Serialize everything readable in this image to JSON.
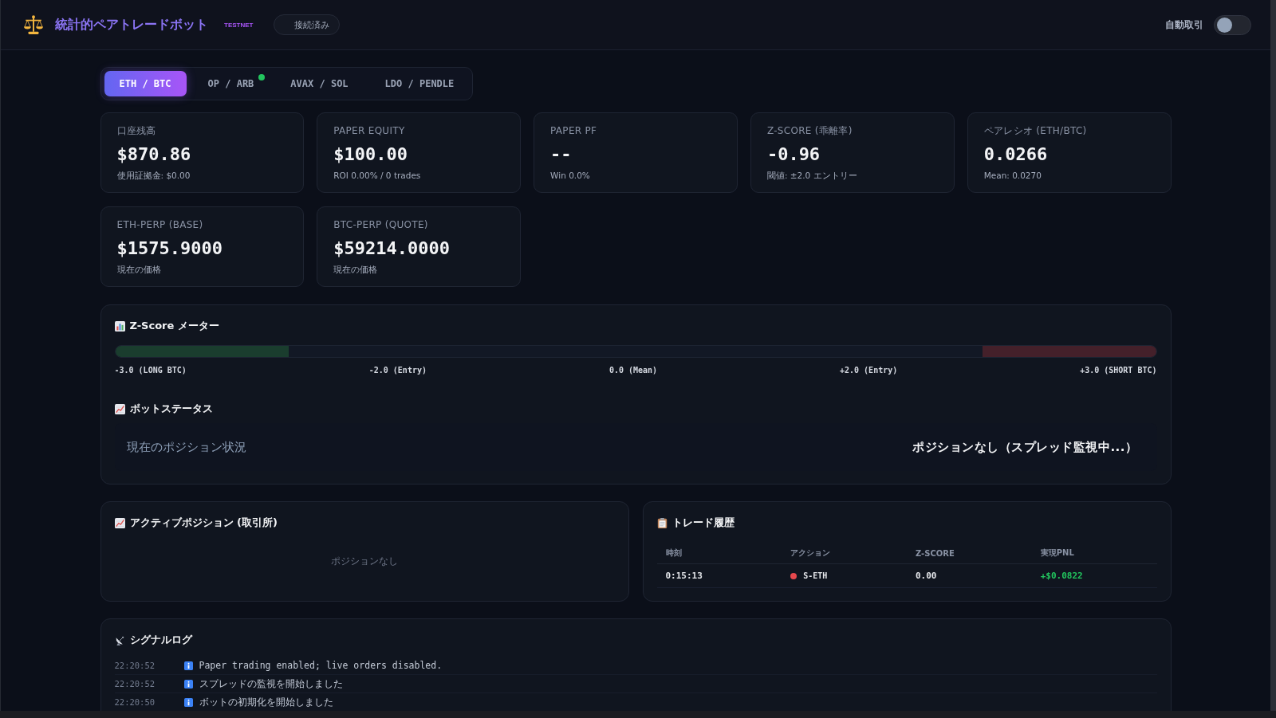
{
  "header": {
    "title": "統計的ペアトレードボット",
    "badge": "TESTNET",
    "connection": "接続済み",
    "auto_trade": {
      "label": "自動取引",
      "on": false
    }
  },
  "pair_tabs": [
    {
      "label": "ETH / BTC",
      "selected": true,
      "indicator": false
    },
    {
      "label": "OP / ARB",
      "selected": false,
      "indicator": true
    },
    {
      "label": "AVAX / SOL",
      "selected": false,
      "indicator": false
    },
    {
      "label": "LDO / PENDLE",
      "selected": false,
      "indicator": false
    }
  ],
  "stats": [
    {
      "label": "口座残高",
      "value": "$870.86",
      "sub": "使用証拠金: $0.00"
    },
    {
      "label": "PAPER EQUITY",
      "value": "$100.00",
      "sub": "ROI 0.00% / 0 trades"
    },
    {
      "label": "PAPER PF",
      "value": "--",
      "sub": "Win 0.0%"
    },
    {
      "label": "Z-SCORE (乖離率)",
      "value": "-0.96",
      "sub": "閾値: ±2.0 エントリー"
    },
    {
      "label": "ペアレシオ (ETH/BTC)",
      "value": "0.0266",
      "sub": "Mean: 0.0270"
    },
    {
      "label": "ETH-PERP (BASE)",
      "value": "$1575.9000",
      "sub": "現在の価格"
    },
    {
      "label": "BTC-PERP (QUOTE)",
      "value": "$59214.0000",
      "sub": "現在の価格"
    }
  ],
  "zscore_meter": {
    "title": "Z-Score メーター",
    "scale": [
      "-3.0 (LONG BTC)",
      "-2.0 (Entry)",
      "0.0 (Mean)",
      "+2.0 (Entry)",
      "+3.0 (SHORT BTC)"
    ]
  },
  "bot_status": {
    "title": "ボットステータス",
    "label": "現在のポジション状況",
    "value": "ポジションなし（スプレッド監視中...）"
  },
  "active_positions": {
    "title": "アクティブポジション (取引所)",
    "empty": "ポジションなし"
  },
  "trade_history": {
    "title": "トレード履歴",
    "columns": [
      "時刻",
      "アクション",
      "Z-SCORE",
      "実現PNL"
    ],
    "rows": [
      {
        "time": "0:15:13",
        "action": "S-ETH",
        "color": "#e5484d",
        "zscore": "0.00",
        "pnl": "+$0.0822",
        "positive": true
      }
    ]
  },
  "signal_log": {
    "title": "シグナルログ",
    "entries": [
      {
        "time": "22:20:52",
        "kind": "info",
        "message": "Paper trading enabled; live orders disabled."
      },
      {
        "time": "22:20:52",
        "kind": "info",
        "message": "スプレッドの監視を開始しました"
      },
      {
        "time": "22:20:50",
        "kind": "info",
        "message": "ボットの初期化を開始しました"
      }
    ]
  }
}
